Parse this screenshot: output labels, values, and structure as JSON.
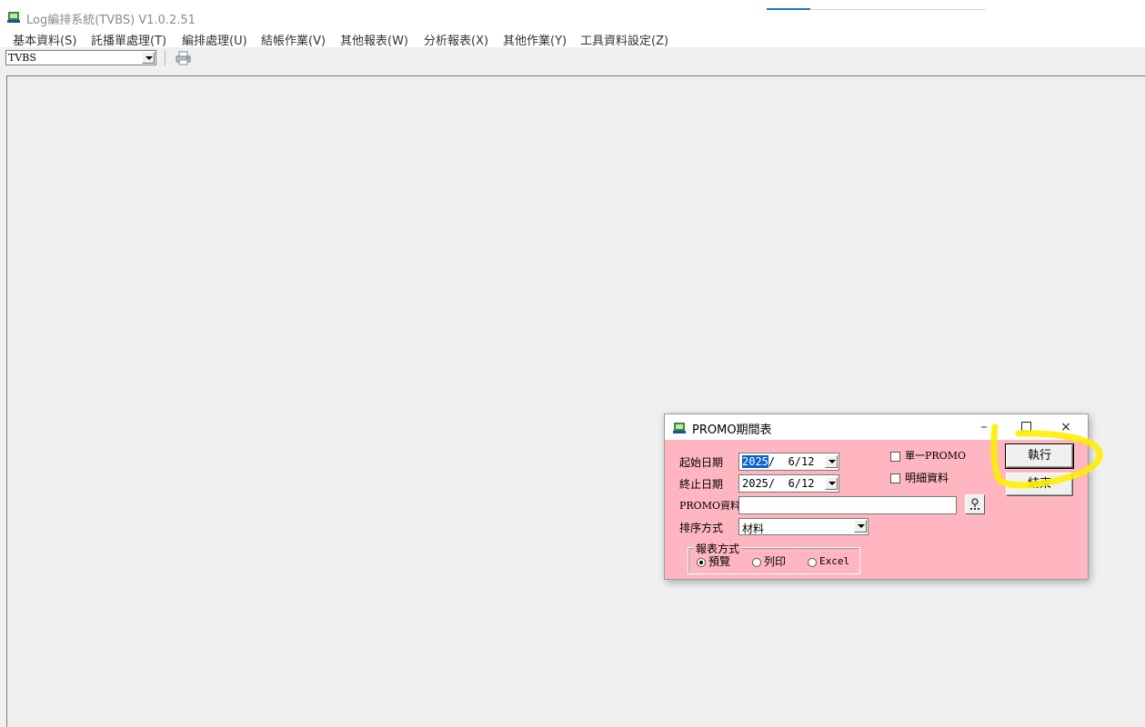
{
  "app": {
    "title": "Log編排系統(TVBS) V1.0.2.51",
    "icon": "tvbs-app-icon"
  },
  "menu": [
    "基本資料(S)",
    "託播單處理(T)",
    "編排處理(U)",
    "結帳作業(V)",
    "其他報表(W)",
    "分析報表(X)",
    "其他作業(Y)",
    "工具資料設定(Z)"
  ],
  "toolbar": {
    "station_value": "TVBS",
    "print_icon": "print-icon"
  },
  "dialog": {
    "title": "PROMO期間表",
    "window_controls": {
      "minimize": "–",
      "close": "×"
    },
    "start_date_label": "起始日期",
    "start_date_year": "2025",
    "start_date_rest": "/  6/12",
    "end_date_label": "終止日期",
    "end_date_value": "2025/  6/12",
    "promo_label": "PROMO資料",
    "promo_value": "",
    "sort_label": "排序方式",
    "sort_value": "材料",
    "single_promo_label": "單一PROMO",
    "single_promo_checked": false,
    "detail_label": "明細資料",
    "detail_checked": false,
    "execute_label": "執行",
    "close_label": "結束",
    "report_group_label": "報表方式",
    "report_options": [
      "預覽",
      "列印",
      "Excel"
    ],
    "report_selected": "預覽"
  },
  "colors": {
    "dialog_bg": "#ffb6c1",
    "mdi_bg": "#efefef",
    "highlight_marker": "#ffee00",
    "selection": "#0a63d0"
  }
}
